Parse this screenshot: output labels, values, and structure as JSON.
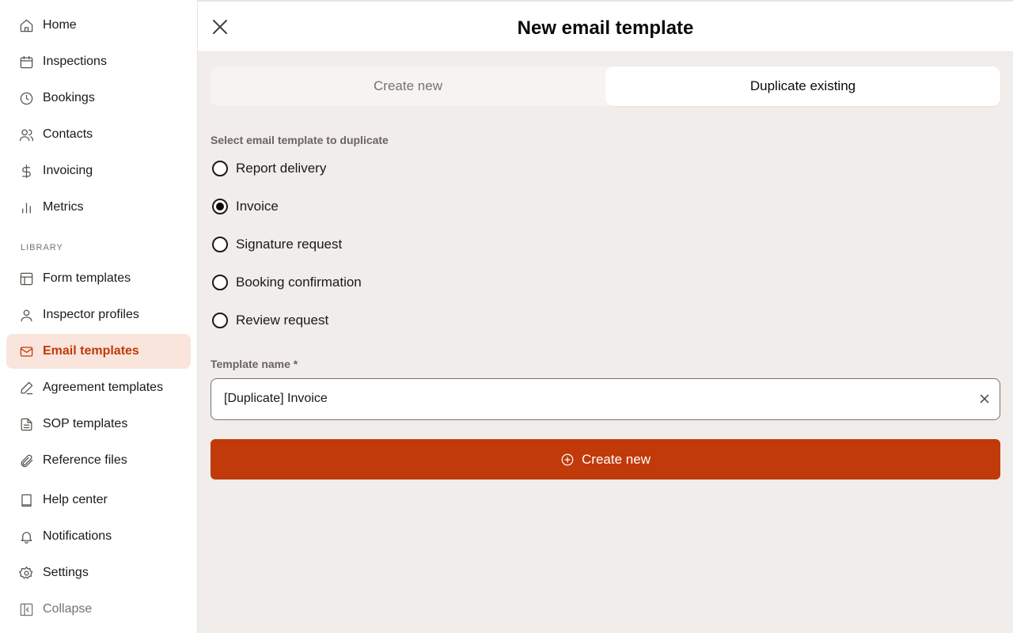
{
  "sidebar": {
    "items": [
      {
        "label": "Home",
        "icon": "home-icon"
      },
      {
        "label": "Inspections",
        "icon": "calendar-icon"
      },
      {
        "label": "Bookings",
        "icon": "clock-icon"
      },
      {
        "label": "Contacts",
        "icon": "users-icon"
      },
      {
        "label": "Invoicing",
        "icon": "dollar-icon"
      },
      {
        "label": "Metrics",
        "icon": "bar-chart-icon"
      }
    ],
    "library_label": "LIBRARY",
    "library_items": [
      {
        "label": "Form templates",
        "icon": "layout-icon"
      },
      {
        "label": "Inspector profiles",
        "icon": "user-icon"
      },
      {
        "label": "Email templates",
        "icon": "mail-icon",
        "active": true
      },
      {
        "label": "Agreement templates",
        "icon": "pen-icon"
      },
      {
        "label": "SOP templates",
        "icon": "file-text-icon"
      },
      {
        "label": "Reference files",
        "icon": "paperclip-icon"
      }
    ],
    "bottom_items": [
      {
        "label": "Help center",
        "icon": "book-icon"
      },
      {
        "label": "Notifications",
        "icon": "bell-icon"
      },
      {
        "label": "Settings",
        "icon": "gear-icon"
      },
      {
        "label": "Collapse",
        "icon": "sidebar-collapse-icon"
      }
    ],
    "active_color": "#c03a0a",
    "active_bg": "#f9e5dc"
  },
  "header": {
    "title": "New email template"
  },
  "tabs": [
    {
      "label": "Create new",
      "selected": false
    },
    {
      "label": "Duplicate existing",
      "selected": true
    }
  ],
  "select_label": "Select email template to duplicate",
  "templates": [
    {
      "label": "Report delivery",
      "checked": false
    },
    {
      "label": "Invoice",
      "checked": true
    },
    {
      "label": "Signature request",
      "checked": false
    },
    {
      "label": "Booking confirmation",
      "checked": false
    },
    {
      "label": "Review request",
      "checked": false
    }
  ],
  "name_field": {
    "label": "Template name *",
    "value": "[Duplicate] Invoice"
  },
  "create_button": {
    "label": "Create new",
    "color": "#c03a0a"
  }
}
